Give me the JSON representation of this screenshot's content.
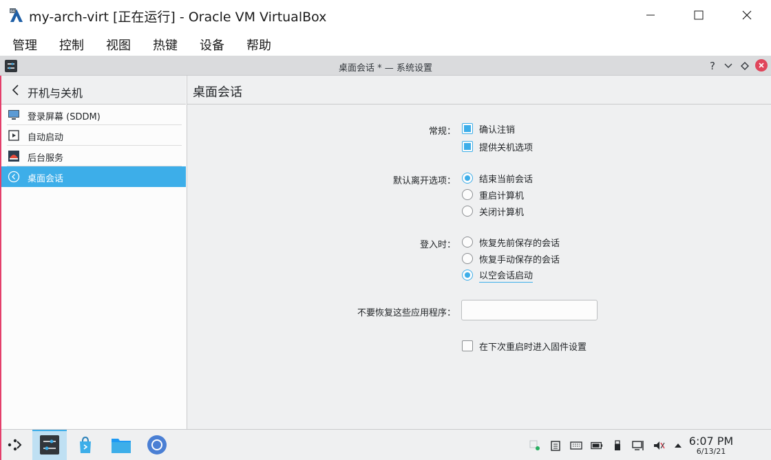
{
  "host": {
    "title": "my-arch-virt [正在运行] - Oracle VM VirtualBox",
    "menu": [
      "管理",
      "控制",
      "视图",
      "热键",
      "设备",
      "帮助"
    ]
  },
  "window": {
    "title": "桌面会话 * — 系统设置"
  },
  "sidebar": {
    "header": "开机与关机",
    "items": [
      {
        "label": "登录屏幕 (SDDM)",
        "icon": "monitor-icon"
      },
      {
        "label": "自动启动",
        "icon": "autostart-icon"
      },
      {
        "label": "后台服务",
        "icon": "services-icon"
      },
      {
        "label": "桌面会话",
        "icon": "session-icon",
        "selected": true
      }
    ]
  },
  "main": {
    "title": "桌面会话",
    "general": {
      "label": "常规：",
      "confirm_logout": "确认注销",
      "offer_shutdown": "提供关机选项"
    },
    "default_leave": {
      "label": "默认离开选项：",
      "end_session": "结束当前会话",
      "restart": "重启计算机",
      "shutdown": "关闭计算机"
    },
    "on_login": {
      "label": "登入时：",
      "restore_previous": "恢复先前保存的会话",
      "restore_manual": "恢复手动保存的会话",
      "empty_session": "以空会话启动"
    },
    "exclude": {
      "label": "不要恢复这些应用程序：",
      "value": ""
    },
    "firmware": "在下次重启时进入固件设置"
  },
  "clock": {
    "time": "6:07 PM",
    "date": "6/13/21"
  },
  "colors": {
    "accent": "#3daee9",
    "close": "#e0455b"
  }
}
